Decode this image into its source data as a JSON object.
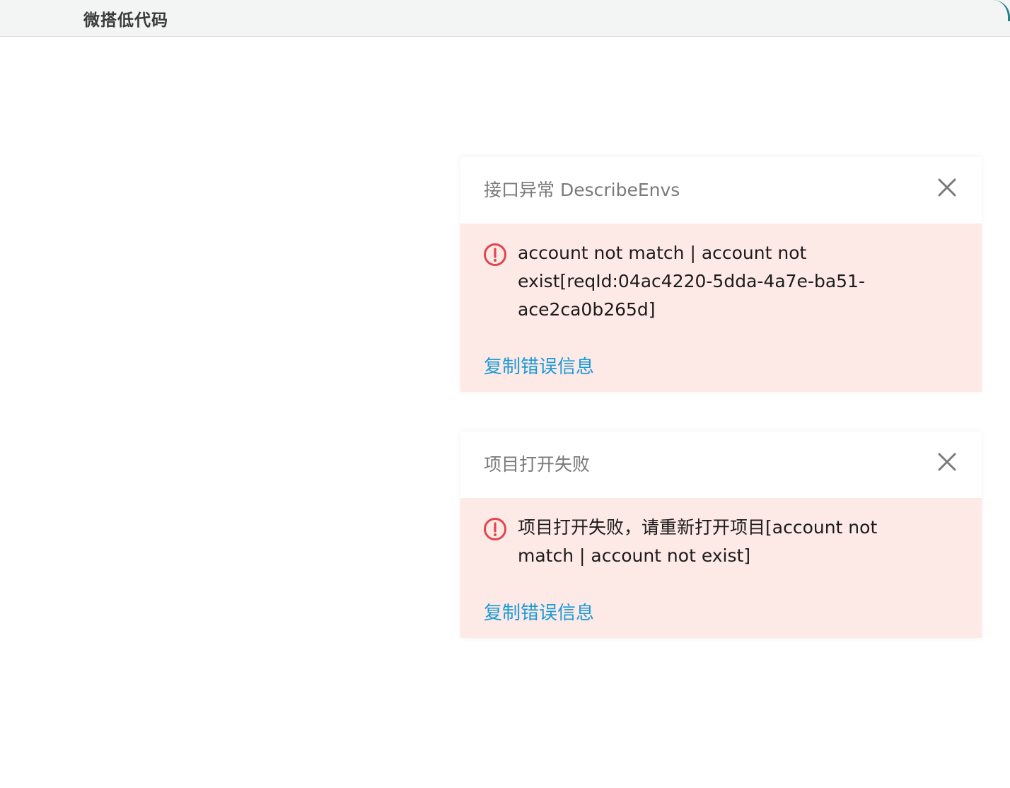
{
  "app": {
    "title": "微搭低代码"
  },
  "notifications": [
    {
      "title": "接口异常 DescribeEnvs",
      "message": "account not match | account not exist[reqId:04ac4220-5dda-4a7e-ba51-ace2ca0b265d]",
      "copy_label": "复制错误信息",
      "close_icon": "close-icon",
      "status_icon": "error-icon"
    },
    {
      "title": "项目打开失败",
      "message": "项目打开失败，请重新打开项目[account not match | account not exist]",
      "copy_label": "复制错误信息",
      "close_icon": "close-icon",
      "status_icon": "error-icon"
    }
  ],
  "colors": {
    "error_bg": "#fde9e6",
    "error_icon": "#e0474c",
    "link": "#1a9ad6",
    "topbar_bg": "#f3f4f4"
  }
}
